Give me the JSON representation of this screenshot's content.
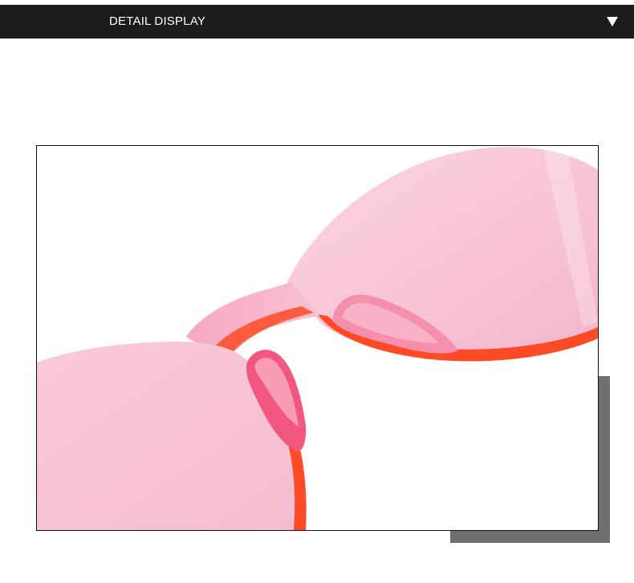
{
  "header": {
    "title": "DETAIL DISPLAY",
    "toggle_icon": "triangle-down-icon"
  },
  "product_image": {
    "subject": "pink-tinted-rimless-sunglasses-closeup",
    "colors": {
      "lens": "#f7c6d8",
      "rim_edge": "#ff4a26",
      "nose_pad": "#f57aa0"
    }
  },
  "decor": {
    "shadow_color": "#6f6f6f"
  }
}
